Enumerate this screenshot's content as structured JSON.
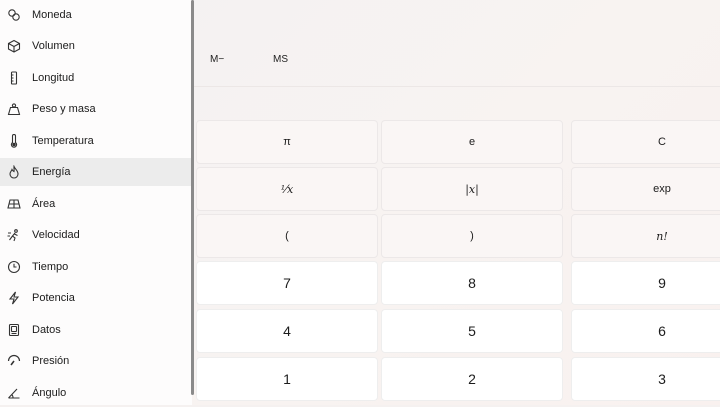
{
  "sidebar": {
    "items": [
      {
        "label": "Moneda",
        "icon": "currency-icon"
      },
      {
        "label": "Volumen",
        "icon": "cube-icon"
      },
      {
        "label": "Longitud",
        "icon": "ruler-icon"
      },
      {
        "label": "Peso y masa",
        "icon": "weight-icon"
      },
      {
        "label": "Temperatura",
        "icon": "thermometer-icon"
      },
      {
        "label": "Energía",
        "icon": "flame-icon",
        "active": true
      },
      {
        "label": "Área",
        "icon": "grid-icon"
      },
      {
        "label": "Velocidad",
        "icon": "speed-icon"
      },
      {
        "label": "Tiempo",
        "icon": "clock-icon"
      },
      {
        "label": "Potencia",
        "icon": "lightning-icon"
      },
      {
        "label": "Datos",
        "icon": "storage-icon"
      },
      {
        "label": "Presión",
        "icon": "gauge-icon"
      },
      {
        "label": "Ángulo",
        "icon": "angle-icon"
      }
    ]
  },
  "memory": {
    "m_minus": "M−",
    "ms": "MS"
  },
  "keypad": {
    "pi": "π",
    "e": "e",
    "clear": "C",
    "reciprocal": "¹⁄x",
    "abs": "|x|",
    "exp": "exp",
    "open_paren": "(",
    "close_paren": ")",
    "factorial": "n!",
    "seven": "7",
    "eight": "8",
    "nine": "9",
    "four": "4",
    "five": "5",
    "six": "6",
    "one": "1",
    "two": "2",
    "three": "3"
  }
}
